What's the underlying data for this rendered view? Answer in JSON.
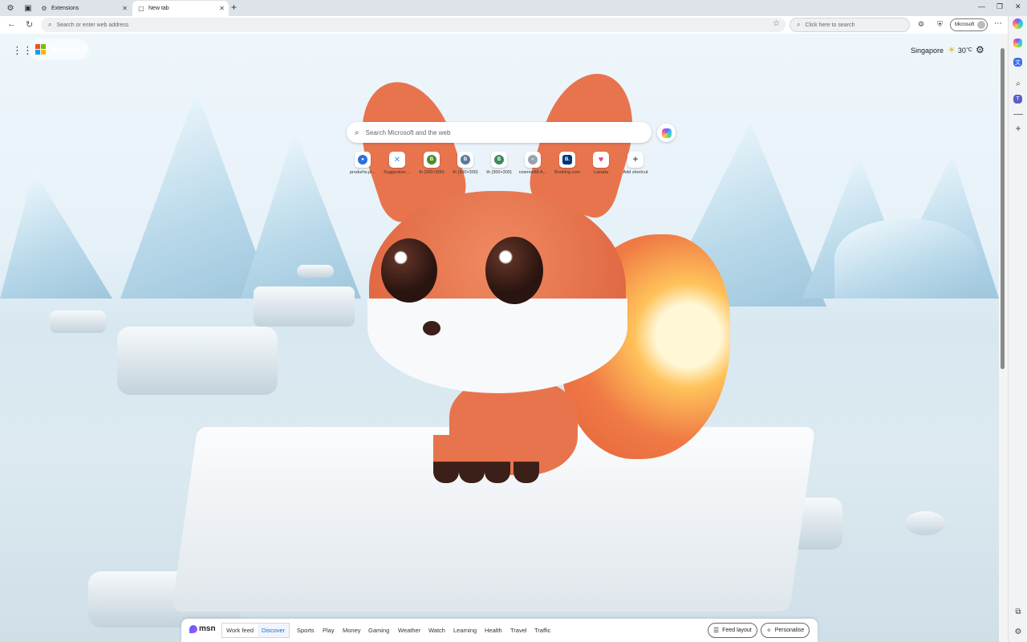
{
  "browser": {
    "tabs": [
      {
        "label": "Extensions",
        "icon": "extensions-icon",
        "active": false
      },
      {
        "label": "New tab",
        "icon": "new-tab-page-icon",
        "active": true
      }
    ],
    "address_placeholder": "Search or enter web address",
    "side_search_placeholder": "Click here to search",
    "profile_label": "Microsoft"
  },
  "page": {
    "brand": "Microsoft",
    "weather": {
      "city": "Singapore",
      "temp": "30",
      "unit": "°C"
    },
    "search_placeholder": "Search Microsoft and the web",
    "quick_links": [
      {
        "label": "produrhs.pl...",
        "glyph": "●",
        "color": "#2f6fe0"
      },
      {
        "label": "Suggestion ...",
        "glyph": "✕",
        "color": "#3a9bd8"
      },
      {
        "label": "th (300×300)",
        "glyph": "B",
        "color": "#4f8a2a"
      },
      {
        "label": "th (300×300)",
        "glyph": "B",
        "color": "#5a7a96"
      },
      {
        "label": "th (300×300)",
        "glyph": "B",
        "color": "#3c8a5c"
      },
      {
        "label": "cosmos88 A...",
        "glyph": "•",
        "color": "#9aa4ad"
      },
      {
        "label": "Booking.com",
        "glyph": "B.",
        "color": "#003580"
      },
      {
        "label": "Lazada",
        "glyph": "♥",
        "color": "#f2437a"
      },
      {
        "label": "Add shortcut",
        "glyph": "+",
        "color": "#555555"
      }
    ]
  },
  "feed": {
    "logo": "msn",
    "tabs": [
      "Work feed",
      "Discover"
    ],
    "selected_tab": "Discover",
    "categories": [
      "Sports",
      "Play",
      "Money",
      "Gaming",
      "Weather",
      "Watch",
      "Learning",
      "Health",
      "Travel",
      "Traffic"
    ],
    "feed_layout_label": "Feed layout",
    "personalise_label": "Personalise"
  }
}
